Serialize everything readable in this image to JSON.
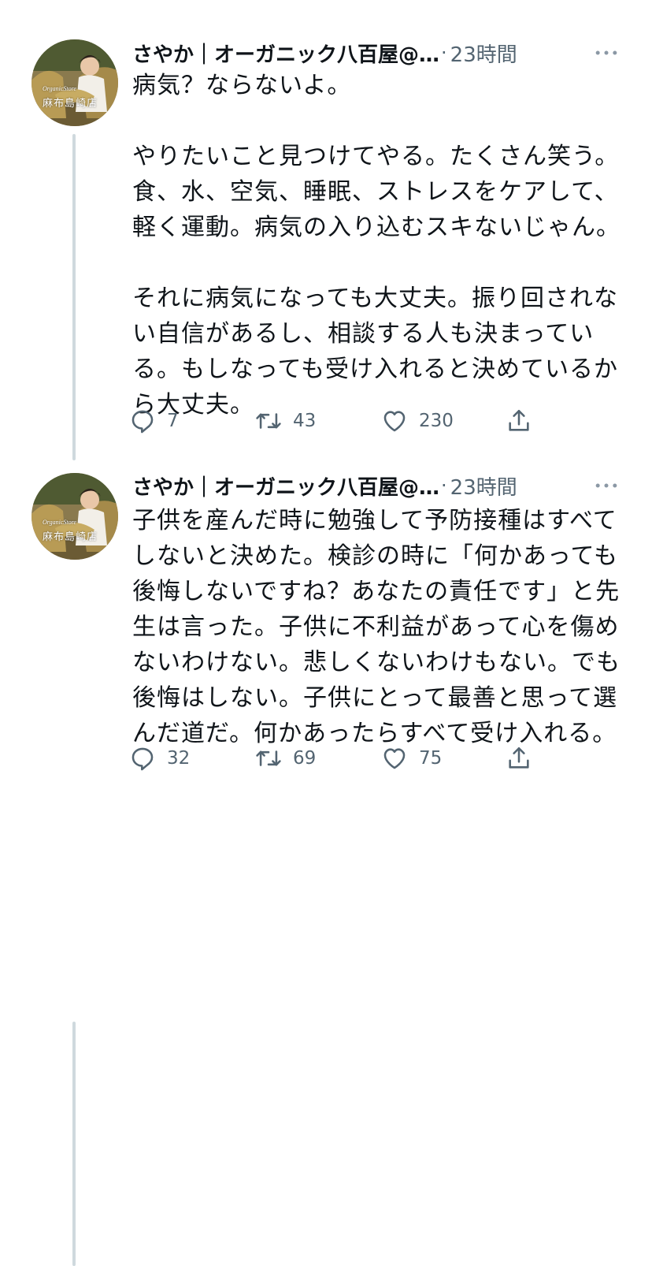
{
  "tweets": [
    {
      "author": {
        "display_name": "さやか｜オーガニック八百屋@…",
        "avatar_brand_text": "OrganicStore",
        "avatar_store_text": "麻布島崎店"
      },
      "separator": "·",
      "time": "23時間",
      "text": "病気？ならないよ。\n\nやりたいこと見つけてやる。たくさん笑う。\n食、水、空気、睡眠、ストレスをケアして、\n軽く運動。病気の入り込むスキないじゃん。\n\nそれに病気になっても大丈夫。振り回されな\nい自信があるし、相談する人も決まってい\nる。もしなっても受け入れると決めているか\nら大丈夫。",
      "reply_count": "7",
      "retweet_count": "43",
      "like_count": "230",
      "icons": {
        "more": "more-horizontal-icon",
        "reply": "reply-icon",
        "retweet": "retweet-icon",
        "like": "heart-icon",
        "share": "share-icon"
      }
    },
    {
      "author": {
        "display_name": "さやか｜オーガニック八百屋@…",
        "avatar_brand_text": "OrganicStore",
        "avatar_store_text": "麻布島崎店"
      },
      "separator": "·",
      "time": "23時間",
      "text": "子供を産んだ時に勉強して予防接種はすべて\nしないと決めた。検診の時に「何かあっても\n後悔しないですね？あなたの責任です」と先\n生は言った。子供に不利益があって心を傷め\nないわけない。悲しくないわけもない。でも\n後悔はしない。子供にとって最善と思って選\nんだ道だ。何かあったらすべて受け入れる。",
      "reply_count": "32",
      "retweet_count": "69",
      "like_count": "75",
      "icons": {
        "more": "more-horizontal-icon",
        "reply": "reply-icon",
        "retweet": "retweet-icon",
        "like": "heart-icon",
        "share": "share-icon"
      }
    }
  ],
  "colors": {
    "text_primary": "#0f1419",
    "text_secondary": "#536471",
    "thread_line": "#cfd9de",
    "background": "#ffffff"
  }
}
